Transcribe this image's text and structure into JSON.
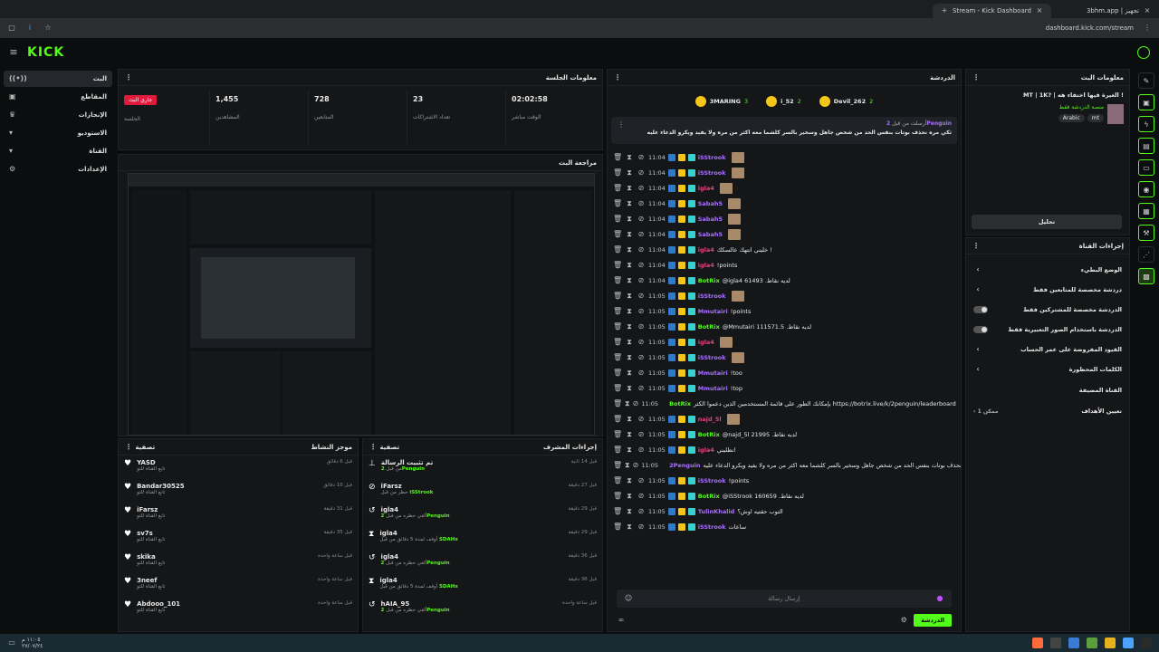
{
  "browser": {
    "tabs": [
      {
        "label": "Stream - Kick Dashboard"
      },
      {
        "label": "3bhm.app | تجهيز"
      }
    ],
    "url": "dashboard.kick.com/stream"
  },
  "brand": {
    "logo": "KICK",
    "accent": "#53fc18"
  },
  "nav": {
    "items": [
      {
        "label": "البث",
        "icon": "broadcast-icon"
      },
      {
        "label": "المقاطع",
        "icon": "clips-icon"
      },
      {
        "label": "الإنجازات",
        "icon": "trophy-icon"
      },
      {
        "label": "الاستوديو",
        "icon": "studio-icon"
      },
      {
        "label": "القناة",
        "icon": "channel-icon"
      },
      {
        "label": "الإعدادات",
        "icon": "gear-icon"
      }
    ]
  },
  "session": {
    "title": "معلومات الجلسة",
    "live_label": "جاري البث",
    "session_label": "الجلسة",
    "stats": [
      {
        "value": "1,455",
        "label": "المشاهدين"
      },
      {
        "value": "728",
        "label": "المتابعين"
      },
      {
        "value": "23",
        "label": "تعداد الاشتراكات"
      },
      {
        "value": "02:02:58",
        "label": "الوقت مباشر"
      }
    ]
  },
  "preview": {
    "title": "مراجعة البث"
  },
  "activity": {
    "title": "موجز النشاط",
    "filter": "تصفية",
    "rows": [
      {
        "name": "YASD",
        "sub": "تابع القناة للتو",
        "time": "قبل 6 دقائق"
      },
      {
        "name": "Bandar30525",
        "sub": "تابع القناة للتو",
        "time": "قبل 10 دقائق"
      },
      {
        "name": "iFarsz",
        "sub": "تابع القناة للتو",
        "time": "قبل 31 دقيقة"
      },
      {
        "name": "sv7s",
        "sub": "تابع القناة للتو",
        "time": "قبل 35 دقيقة"
      },
      {
        "name": "skika",
        "sub": "تابع القناة للتو",
        "time": "قبل ساعة واحدة"
      },
      {
        "name": "3neef",
        "sub": "تابع القناة للتو",
        "time": "قبل ساعة واحدة"
      },
      {
        "name": "Abdooo_101",
        "sub": "تابع القناة للتو",
        "time": "قبل ساعة واحدة"
      }
    ]
  },
  "modactions": {
    "title": "إجراءات المشرف",
    "filter": "تصفية",
    "rows": [
      {
        "name": "تم تثبيت الرسالة",
        "sub": "2Penguin",
        "pre": "من قبل",
        "time": "قبل 14 ثانية",
        "icon": "pin-icon"
      },
      {
        "name": "iFarsz",
        "sub": "iSStrook",
        "pre": "حظر من قبل",
        "time": "قبل 27 دقيقة",
        "icon": "ban-icon"
      },
      {
        "name": "igla4",
        "sub": "2Penguin",
        "pre": "ألغي حظره من قبل",
        "time": "قبل 29 دقيقة",
        "icon": "undo-icon"
      },
      {
        "name": "igla4",
        "sub": "SDAHx",
        "pre": "أوقف لمدة 5 دقائق من قبل",
        "time": "قبل 29 دقيقة",
        "icon": "hourglass-icon"
      },
      {
        "name": "igla4",
        "sub": "2Penguin",
        "pre": "ألغي حظره من قبل",
        "time": "قبل 36 دقيقة",
        "icon": "undo-icon"
      },
      {
        "name": "igla4",
        "sub": "SDAHx",
        "pre": "أوقف لمدة 5 دقائق من قبل",
        "time": "قبل 36 دقيقة",
        "icon": "hourglass-icon"
      },
      {
        "name": "hAIA_95",
        "sub": "2Penguin",
        "pre": "ألغي حظره من قبل",
        "time": "قبل ساعة واحدة",
        "icon": "undo-icon"
      }
    ]
  },
  "chat": {
    "title": "الدردشة",
    "top": [
      {
        "name": "3MARING",
        "count": "3"
      },
      {
        "name": "i_52",
        "count": "2"
      },
      {
        "name": "Devil_262",
        "count": "2"
      }
    ],
    "pinned": {
      "label": "أرسلت من قبل",
      "user": "2Penguin",
      "text": "ثكي مره نحذف بوتات بنفس الحد من شخص جاهل وسخير بالسر كلشما معه اكثر من مره ولا يفيد ويكرو الدعاء عليه"
    },
    "lines": [
      {
        "time": "11:04",
        "user": "iSStrook",
        "msg": "",
        "color": "#a970ff"
      },
      {
        "time": "11:04",
        "user": "iSStrook",
        "msg": "",
        "color": "#a970ff"
      },
      {
        "time": "11:04",
        "user": "igla4",
        "msg": "",
        "color": "#e0457b"
      },
      {
        "time": "11:04",
        "user": "Sabah5",
        "msg": "",
        "color": "#a970ff"
      },
      {
        "time": "11:04",
        "user": "Sabah5",
        "msg": "",
        "color": "#a970ff"
      },
      {
        "time": "11:04",
        "user": "Sabah5",
        "msg": "",
        "color": "#a970ff"
      },
      {
        "time": "11:04",
        "user": "igla4",
        "msg": "خليني انتهك عالسكك !",
        "color": "#e0457b"
      },
      {
        "time": "11:04",
        "user": "igla4",
        "msg": "!points",
        "color": "#e0457b"
      },
      {
        "time": "11:04",
        "user": "BotRix",
        "msg": "@igla4 61493 .لديه نقاط",
        "color": "#53fc18"
      },
      {
        "time": "11:05",
        "user": "iSStrook",
        "msg": "",
        "color": "#a970ff"
      },
      {
        "time": "11:05",
        "user": "Mmutairi",
        "msg": "!points",
        "color": "#a970ff"
      },
      {
        "time": "11:05",
        "user": "BotRix",
        "msg": "@Mmutairi 111571.5 .لديه نقاط",
        "color": "#53fc18"
      },
      {
        "time": "11:05",
        "user": "igla4",
        "msg": "",
        "color": "#e0457b"
      },
      {
        "time": "11:05",
        "user": "iSStrook",
        "msg": "",
        "color": "#a970ff"
      },
      {
        "time": "11:05",
        "user": "Mmutairi",
        "msg": "!too",
        "color": "#a970ff"
      },
      {
        "time": "11:05",
        "user": "Mmutairi",
        "msg": "!top",
        "color": "#a970ff"
      },
      {
        "time": "11:05",
        "user": "BotRix",
        "msg": "بإمكانك الطور على قائمة المستخدمين الذين دعموا الكثر https://botrix.live/k/2penguin/leaderboard",
        "color": "#53fc18"
      },
      {
        "time": "11:05",
        "user": "najd_5l",
        "msg": "",
        "color": "#e0457b"
      },
      {
        "time": "11:05",
        "user": "BotRix",
        "msg": "@najd_5l 21995 .لديه نقاط",
        "color": "#53fc18"
      },
      {
        "time": "11:05",
        "user": "igla4",
        "msg": "انطليني",
        "color": "#e0457b"
      },
      {
        "time": "11:05",
        "user": "2Penguin",
        "msg": "ثكي مره نحذف بوتات بنفس الحد من شخص جاهل وسخير بالسر كلشما معه اكثر من مره ولا يفيد ويكرو الدعاء عليه",
        "color": "#a970ff"
      },
      {
        "time": "11:05",
        "user": "iSStrook",
        "msg": "!points",
        "color": "#a970ff"
      },
      {
        "time": "11:05",
        "user": "BotRix",
        "msg": "@iSStrook 160659 .لديه نقاط",
        "color": "#53fc18"
      },
      {
        "time": "11:05",
        "user": "TulinKhalid",
        "msg": "التوب حقتيه اوش؟",
        "color": "#a970ff"
      },
      {
        "time": "11:05",
        "user": "iSStrook",
        "msg": "ساعات",
        "color": "#a970ff"
      }
    ],
    "input_placeholder": "إرسال رسالة",
    "send_label": "الدردشة"
  },
  "streaminfo": {
    "title": "معلومات البث",
    "stream_title": "MT | 1K? | الغيرة فيها اختفاء هه !",
    "category": "منصة الدردشة فقط",
    "tags": [
      "Arabic",
      "mt"
    ],
    "edit_label": "تحليل"
  },
  "channelactions": {
    "title": "إجراءات القناة",
    "rows": [
      {
        "label": "الوضع البطيء",
        "control": "chevron"
      },
      {
        "label": "دردشة مخصصة للمتابعين فقط",
        "control": "chevron"
      },
      {
        "label": "الدردشة مخصصة للمشتركين فقط",
        "control": "toggle"
      },
      {
        "label": "الدردشة باستخدام الصور التعبيرية فقط",
        "control": "toggle"
      },
      {
        "label": "القيود المفروضة على عمر الحساب",
        "control": "chevron"
      },
      {
        "label": "الكلمات المحظورة",
        "control": "chevron"
      }
    ],
    "host_heading": "القناة المضيفة",
    "goals_label": "تعيين الأهداف",
    "goals_status": "ممكن 1"
  },
  "taskbar": {
    "date": "٢٧/٠٧/٢٤",
    "time": "١١:٠٥ م"
  }
}
